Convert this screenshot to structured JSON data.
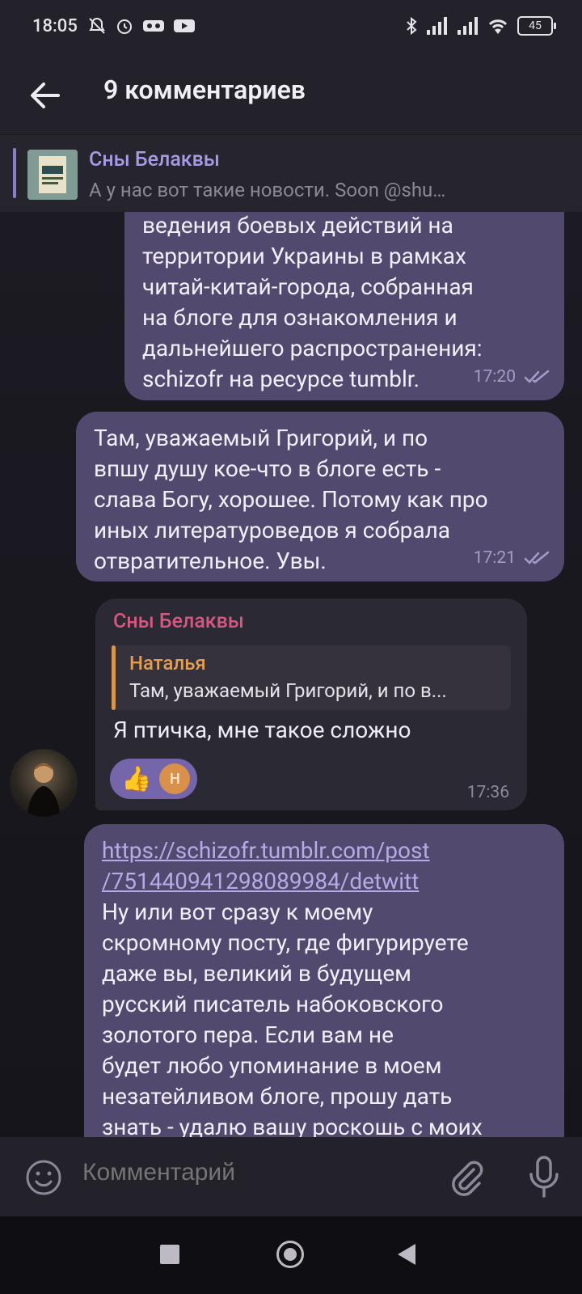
{
  "status": {
    "time": "18:05",
    "battery": "45",
    "left_icons": [
      "mute-icon",
      "alarm-icon",
      "voicemail-icon",
      "youtube-icon"
    ],
    "right_icons": [
      "bluetooth-icon",
      "signal-icon",
      "signal-icon",
      "wifi-icon",
      "battery-icon"
    ]
  },
  "appbar": {
    "title": "9 комментариев"
  },
  "pinned": {
    "title": "Сны Белаквы",
    "text": "А у нас вот такие новости. Soon @shu…"
  },
  "messages": {
    "m1": {
      "text": "ведения боевых действий на\nтерритории Украины в рамках\nчитай-китай-города, собранная\nна блоге для ознакомления и\nдальнейшего распространения:\nschizofr на ресурсе tumblr.",
      "time": "17:20"
    },
    "m2": {
      "text": "Там, уважаемый Григорий, и по\nвпшу душу кое-что в блоге есть -\nслава Богу, хорошее. Потому как про\nиных литературоведов я собрала\nотвратительное. Увы.",
      "time": "17:21"
    },
    "m3": {
      "sender": "Сны Белаквы",
      "reply_name": "Наталья",
      "reply_text": "Там, уважаемый Григорий, и по в...",
      "text": "Я птичка, мне такое сложно",
      "reaction_emoji": "👍",
      "reaction_avatar": "Н",
      "time": "17:36"
    },
    "m4": {
      "link": "https://schizofr.tumblr.com/post\n/751440941298089984/detwitt",
      "text": "Ну или вот сразу к моему\nскромному посту, где фигурируете\nдаже вы, великий в будущем\nрусский писатель набоковского\nзолотого пера. Если вам не\nбудет любо упоминание в моем\nнезатейливом блоге, прошу дать\nзнать - удалю вашу роскошь с моих"
    }
  },
  "composer": {
    "placeholder": "Комментарий"
  },
  "colors": {
    "outgoing_bubble": "#52496f",
    "incoming_bubble": "#2b2933",
    "accent": "#a79be6"
  }
}
